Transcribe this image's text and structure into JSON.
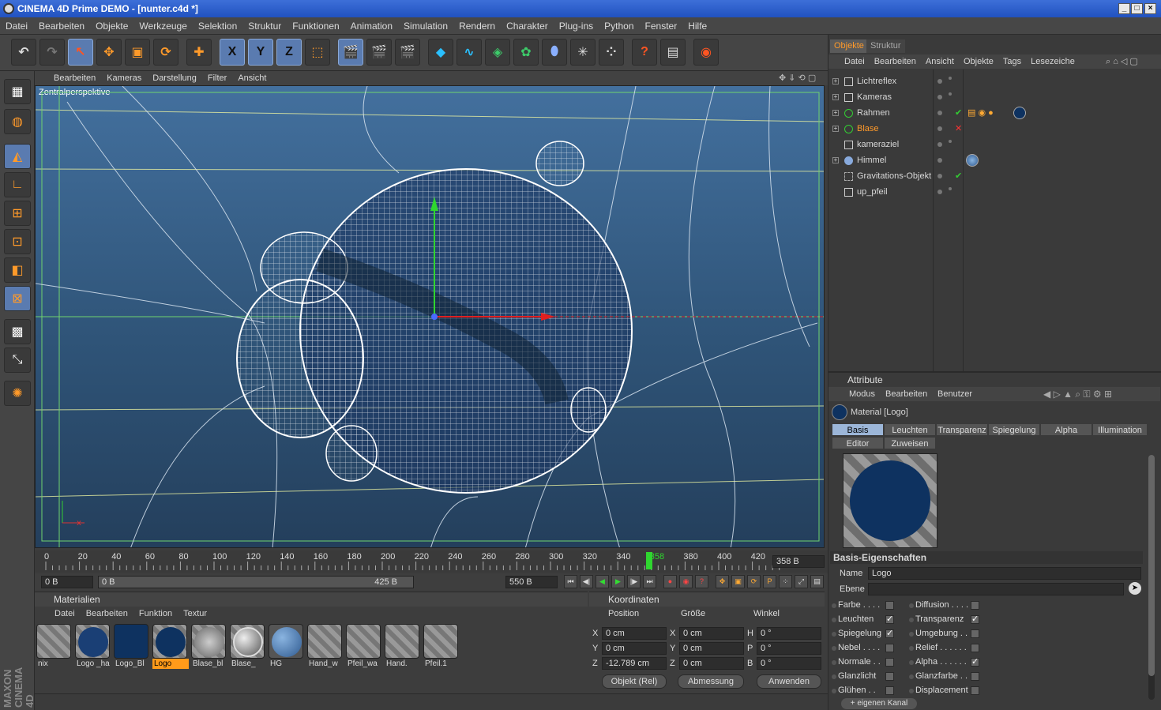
{
  "window": {
    "title": "CINEMA 4D Prime DEMO - [nunter.c4d *]"
  },
  "menu": [
    "Datei",
    "Bearbeiten",
    "Objekte",
    "Werkzeuge",
    "Selektion",
    "Struktur",
    "Funktionen",
    "Animation",
    "Simulation",
    "Rendern",
    "Charakter",
    "Plug-ins",
    "Python",
    "Fenster",
    "Hilfe"
  ],
  "toolbar": {
    "x": "X",
    "y": "Y",
    "z": "Z",
    "help": "?"
  },
  "viewport": {
    "menu": [
      "Bearbeiten",
      "Kameras",
      "Darstellung",
      "Filter",
      "Ansicht"
    ],
    "label": "Zentralperspektive"
  },
  "timeline": {
    "ticks": [
      "0",
      "20",
      "40",
      "60",
      "80",
      "100",
      "120",
      "140",
      "160",
      "180",
      "200",
      "220",
      "240",
      "260",
      "280",
      "300",
      "320",
      "340",
      "358",
      "380",
      "400",
      "420"
    ],
    "current": "358 B",
    "start": "0 B",
    "range_start": "0 B",
    "range_end": "425 B",
    "end": "550 B"
  },
  "materials": {
    "title": "Materialien",
    "menu": [
      "Datei",
      "Bearbeiten",
      "Funktion",
      "Textur"
    ],
    "items": [
      {
        "name": "nix"
      },
      {
        "name": "Logo _ha"
      },
      {
        "name": "Logo_Bl"
      },
      {
        "name": "Logo"
      },
      {
        "name": "Blase_bl"
      },
      {
        "name": "Blase_"
      },
      {
        "name": "HG"
      },
      {
        "name": "Hand_w"
      },
      {
        "name": "Pfeil_wa"
      },
      {
        "name": "Hand."
      },
      {
        "name": "Pfeil.1"
      }
    ]
  },
  "coords": {
    "title": "Koordinaten",
    "col_position": "Position",
    "col_size": "Größe",
    "col_angle": "Winkel",
    "rows": [
      {
        "axis": "X",
        "pos": "0 cm",
        "saxis": "X",
        "size": "0 cm",
        "aaxis": "H",
        "angle": "0 °"
      },
      {
        "axis": "Y",
        "pos": "0 cm",
        "saxis": "Y",
        "size": "0 cm",
        "aaxis": "P",
        "angle": "0 °"
      },
      {
        "axis": "Z",
        "pos": "-12.789 cm",
        "saxis": "Z",
        "size": "0 cm",
        "aaxis": "B",
        "angle": "0 °"
      }
    ],
    "mode": "Objekt (Rel)",
    "size_mode": "Abmessung",
    "apply": "Anwenden"
  },
  "objects": {
    "tab_objects": "Objekte",
    "tab_structure": "Struktur",
    "menu": [
      "Datei",
      "Bearbeiten",
      "Ansicht",
      "Objekte",
      "Tags",
      "Lesezeiche"
    ],
    "items": [
      "Lichtreflex",
      "Kameras",
      "Rahmen",
      "Blase",
      "kameraziel",
      "Himmel",
      "Gravitations-Objekt",
      "up_pfeil"
    ]
  },
  "attributes": {
    "title": "Attribute",
    "menu": [
      "Modus",
      "Bearbeiten",
      "Benutzer"
    ],
    "material": "Material [Logo]",
    "tabs": [
      "Basis",
      "Leuchten",
      "Transparenz",
      "Spiegelung",
      "Alpha",
      "Illumination",
      "Editor",
      "Zuweisen"
    ],
    "section": "Basis-Eigenschaften",
    "name_label": "Name",
    "name_value": "Logo",
    "layer_label": "Ebene",
    "left_props": [
      "Farbe . . . .",
      "Leuchten",
      "Spiegelung",
      "Nebel . . . .",
      "Normale . .",
      "Glanzlicht",
      "Glühen . ."
    ],
    "right_props": [
      "Diffusion . . . .",
      "Transparenz",
      "Umgebung . .",
      "Relief . . . . . .",
      "Alpha . . . . . .",
      "Glanzfarbe . .",
      "Displacement"
    ],
    "left_checked": [
      false,
      true,
      true,
      false,
      false,
      false,
      false
    ],
    "right_checked": [
      false,
      true,
      false,
      false,
      true,
      false,
      false
    ],
    "bottom_btn": "+ eigenen Kanal"
  },
  "brand": "MAXON CINEMA 4D",
  "colors": {
    "accent": "#ff9a2a",
    "material_blue": "#0e3260",
    "viewport_top": "#43709e"
  }
}
